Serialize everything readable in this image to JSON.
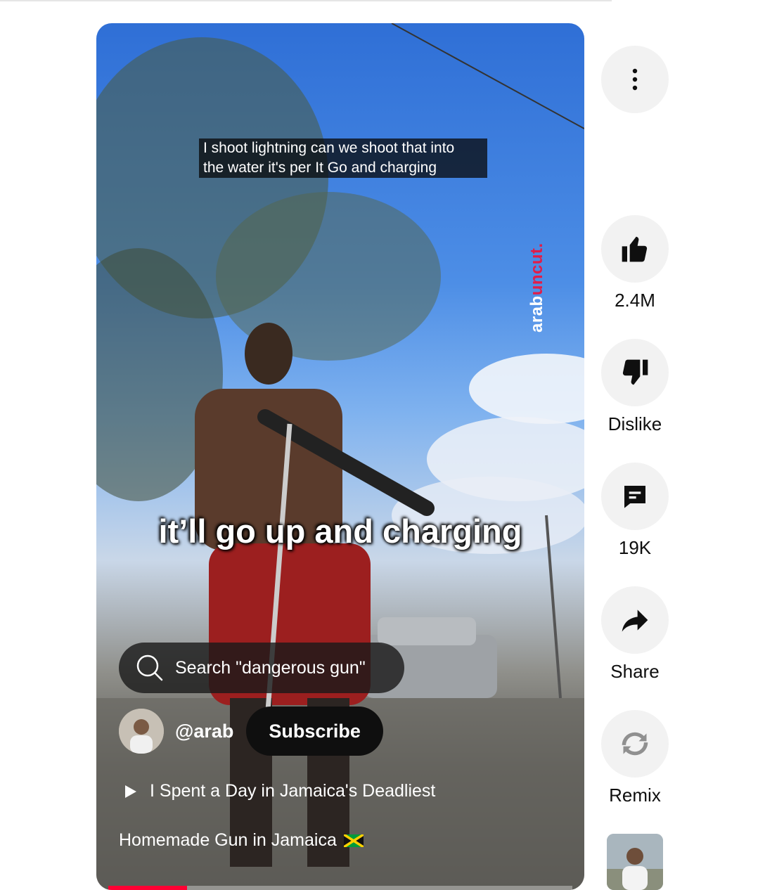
{
  "video": {
    "caption_box": "I shoot lightning can we shoot that into\nthe water it's per It Go and charging",
    "watermark_a": "arab",
    "watermark_b": "uncut.",
    "subtitle": "it’ll go up and charging",
    "search_label": "Search \"dangerous gun\"",
    "channel_handle": "@arab",
    "subscribe_label": "Subscribe",
    "related_label": "I Spent a Day in Jamaica's Deadliest",
    "title": "Homemade Gun in Jamaica",
    "progress_fraction": 0.17
  },
  "actions": {
    "like_count": "2.4M",
    "dislike_label": "Dislike",
    "comment_count": "19K",
    "share_label": "Share",
    "remix_label": "Remix"
  },
  "icons": [
    "more-vert-icon",
    "thumb-up-icon",
    "thumb-down-icon",
    "comment-icon",
    "share-icon",
    "remix-icon",
    "search-icon",
    "play-icon",
    "jamaica-flag-icon"
  ],
  "colors": {
    "accent": "#ff0033",
    "watermark_accent": "#e11d48",
    "button_bg": "#f2f2f2",
    "subscribe_bg": "#0f0f0f"
  }
}
